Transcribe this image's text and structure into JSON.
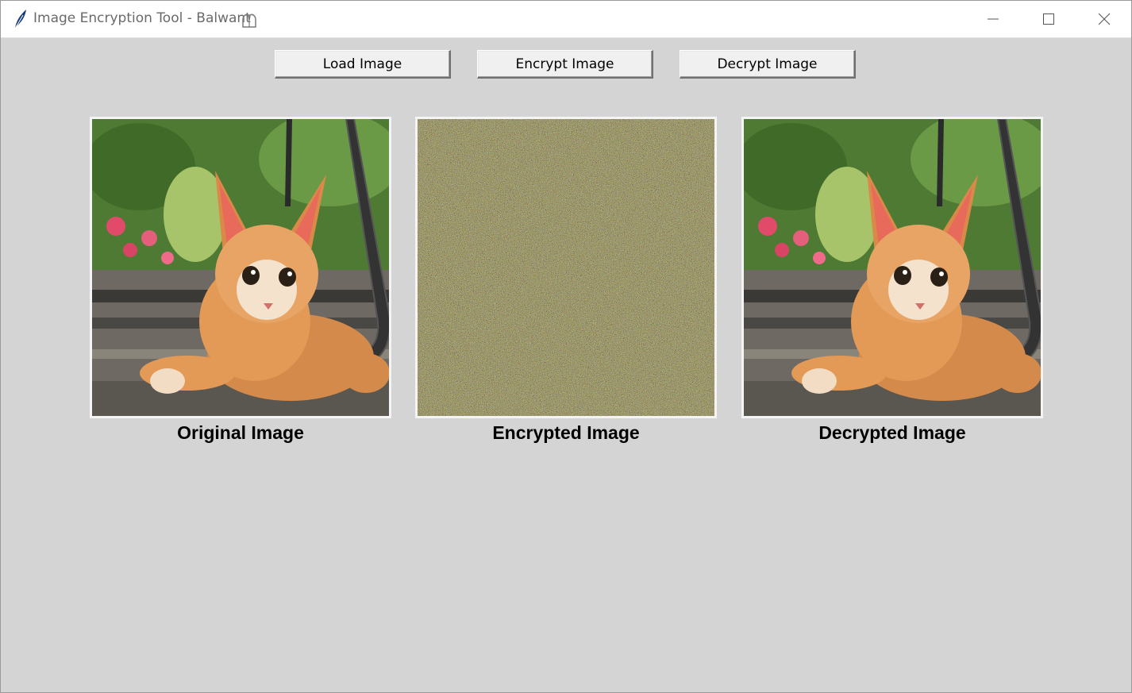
{
  "window": {
    "title": "Image Encryption Tool - Balwant",
    "title_icon": "feather-icon",
    "title_emoji": "praying-hands-emoji-icon",
    "controls": [
      "minimize-icon",
      "maximize-icon",
      "close-icon"
    ]
  },
  "toolbar": {
    "load_label": "Load Image",
    "encrypt_label": "Encrypt Image",
    "decrypt_label": "Decrypt Image"
  },
  "panels": {
    "original_caption": "Original Image",
    "encrypted_caption": "Encrypted Image",
    "decrypted_caption": "Decrypted Image"
  },
  "colors": {
    "window_bg": "#d4d4d4",
    "button_bg": "#f0f0f0",
    "noise_base": "#6e6a58"
  }
}
